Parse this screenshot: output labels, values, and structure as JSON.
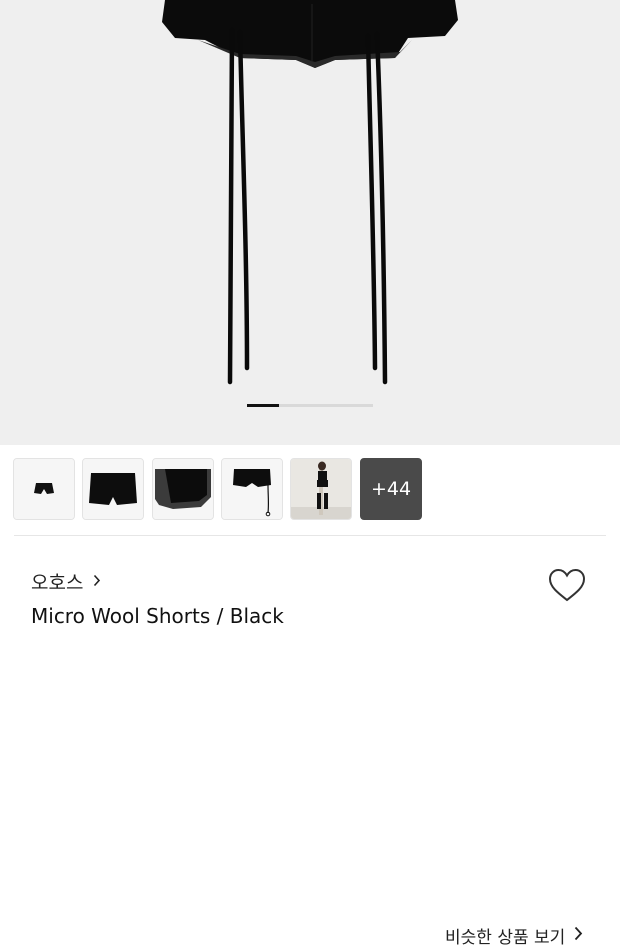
{
  "hero": {
    "image": "black-micro-wool-shorts-with-drawstrings",
    "slide_position": 0.25
  },
  "thumbnails": [
    {
      "image": "shorts-thumb-small"
    },
    {
      "image": "shorts-thumb-front"
    },
    {
      "image": "shorts-thumb-detail"
    },
    {
      "image": "shorts-thumb-drawstring"
    },
    {
      "image": "shorts-thumb-model"
    }
  ],
  "more_thumbs": {
    "label": "+44"
  },
  "similar": {
    "label": "비슷한 상품 보기",
    "icon": "chevron-right-icon"
  },
  "brand": {
    "name": "오호스",
    "icon": "chevron-right-icon"
  },
  "product": {
    "title": "Micro Wool Shorts / Black"
  },
  "wishlist": {
    "icon": "heart-icon"
  },
  "colors": {
    "text": "#222222",
    "hero_bg": "#efefef",
    "accent": "#111111"
  }
}
